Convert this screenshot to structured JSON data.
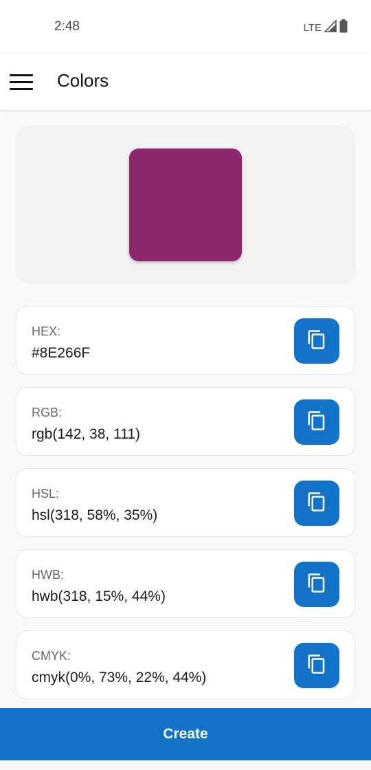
{
  "status_bar": {
    "time": "2:48",
    "network": "LTE"
  },
  "app_bar": {
    "title": "Colors"
  },
  "preview": {
    "color": "#8E266F"
  },
  "values": [
    {
      "label": "HEX:",
      "value": "#8E266F"
    },
    {
      "label": "RGB:",
      "value": "rgb(142, 38, 111)"
    },
    {
      "label": "HSL:",
      "value": "hsl(318, 58%, 35%)"
    },
    {
      "label": "HWB:",
      "value": "hwb(318, 15%, 44%)"
    },
    {
      "label": "CMYK:",
      "value": "cmyk(0%, 73%, 22%, 44%)"
    }
  ],
  "actions": {
    "create_label": "Create"
  },
  "colors": {
    "accent": "#1273C8",
    "swatch": "#8E266F"
  }
}
